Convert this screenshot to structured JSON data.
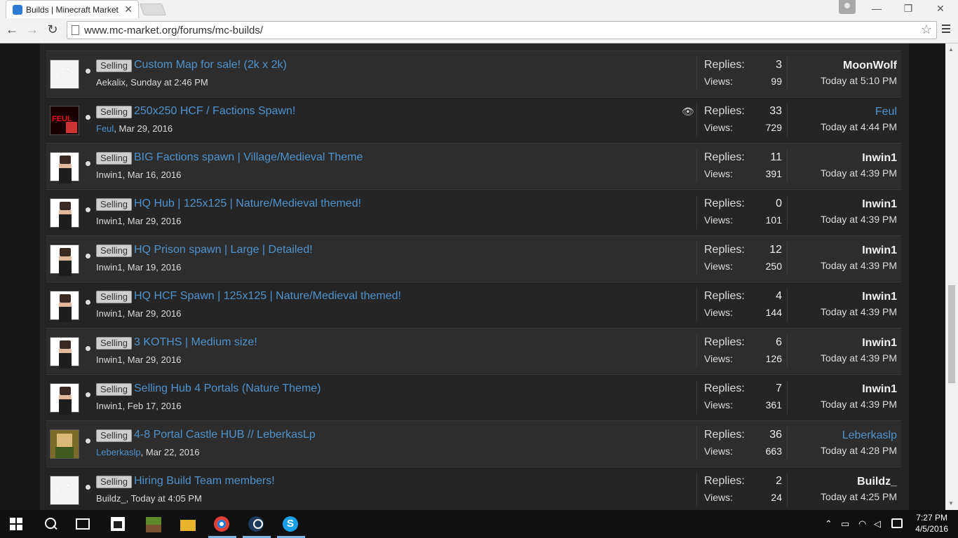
{
  "browser": {
    "tab_title": "Builds | Minecraft Market",
    "url": "www.mc-market.org/forums/mc-builds/",
    "close_tab": "✕",
    "minimize": "—",
    "restore": "❐",
    "close_window": "✕"
  },
  "threads": [
    {
      "prefix": "Selling",
      "title": "Custom Map for sale! (2k x 2k)",
      "author": "Aekalix",
      "date": ", Sunday at 2:46 PM",
      "replies_label": "Replies:",
      "replies": "3",
      "views_label": "Views:",
      "views": "99",
      "last_user": "MoonWolf",
      "last_date": "Today at 5:10 PM",
      "avatar": "gender",
      "author_link": false,
      "last_link": false
    },
    {
      "prefix": "Selling",
      "title": "250x250 HCF / Factions Spawn!",
      "author": "Feul",
      "date": ", Mar 29, 2016",
      "replies_label": "Replies:",
      "replies": "33",
      "views_label": "Views:",
      "views": "729",
      "last_user": "Feul",
      "last_date": "Today at 4:44 PM",
      "avatar": "feul",
      "author_link": true,
      "last_link": true,
      "watched": true
    },
    {
      "prefix": "Selling",
      "title": "BIG Factions spawn | Village/Medieval Theme",
      "author": "Inwin1",
      "date": ", Mar 16, 2016",
      "replies_label": "Replies:",
      "replies": "11",
      "views_label": "Views:",
      "views": "391",
      "last_user": "Inwin1",
      "last_date": "Today at 4:39 PM",
      "avatar": "skin",
      "author_link": false,
      "last_link": false
    },
    {
      "prefix": "Selling",
      "title": "HQ Hub | 125x125 | Nature/Medieval themed!",
      "author": "Inwin1",
      "date": ", Mar 29, 2016",
      "replies_label": "Replies:",
      "replies": "0",
      "views_label": "Views:",
      "views": "101",
      "last_user": "Inwin1",
      "last_date": "Today at 4:39 PM",
      "avatar": "skin",
      "author_link": false,
      "last_link": false
    },
    {
      "prefix": "Selling",
      "title": "HQ Prison spawn | Large | Detailed!",
      "author": "Inwin1",
      "date": ", Mar 19, 2016",
      "replies_label": "Replies:",
      "replies": "12",
      "views_label": "Views:",
      "views": "250",
      "last_user": "Inwin1",
      "last_date": "Today at 4:39 PM",
      "avatar": "skin",
      "author_link": false,
      "last_link": false
    },
    {
      "prefix": "Selling",
      "title": "HQ HCF Spawn | 125x125 | Nature/Medieval themed!",
      "author": "Inwin1",
      "date": ", Mar 29, 2016",
      "replies_label": "Replies:",
      "replies": "4",
      "views_label": "Views:",
      "views": "144",
      "last_user": "Inwin1",
      "last_date": "Today at 4:39 PM",
      "avatar": "skin",
      "author_link": false,
      "last_link": false
    },
    {
      "prefix": "Selling",
      "title": "3 KOTHS | Medium size!",
      "author": "Inwin1",
      "date": ", Mar 29, 2016",
      "replies_label": "Replies:",
      "replies": "6",
      "views_label": "Views:",
      "views": "126",
      "last_user": "Inwin1",
      "last_date": "Today at 4:39 PM",
      "avatar": "skin",
      "author_link": false,
      "last_link": false
    },
    {
      "prefix": "Selling",
      "title": "Selling Hub 4 Portals (Nature Theme)",
      "author": "Inwin1",
      "date": ", Feb 17, 2016",
      "replies_label": "Replies:",
      "replies": "7",
      "views_label": "Views:",
      "views": "361",
      "last_user": "Inwin1",
      "last_date": "Today at 4:39 PM",
      "avatar": "skin",
      "author_link": false,
      "last_link": false
    },
    {
      "prefix": "Selling",
      "title": "4-8 Portal Castle HUB // LeberkasLp",
      "author": "Leberkaslp",
      "date": ", Mar 22, 2016",
      "replies_label": "Replies:",
      "replies": "36",
      "views_label": "Views:",
      "views": "663",
      "last_user": "Leberkaslp",
      "last_date": "Today at 4:28 PM",
      "avatar": "leber",
      "author_link": true,
      "last_link": true
    },
    {
      "prefix": "Selling",
      "title": "Hiring Build Team members!",
      "author": "Buildz_",
      "date": ", Today at 4:05 PM",
      "replies_label": "Replies:",
      "replies": "2",
      "views_label": "Views:",
      "views": "24",
      "last_user": "Buildz_",
      "last_date": "Today at 4:25 PM",
      "avatar": "gender",
      "author_link": false,
      "last_link": false
    }
  ],
  "taskbar": {
    "time": "7:27 PM",
    "date": "4/5/2016"
  },
  "colors": {
    "link": "#4f93ce",
    "page_bg": "#171717",
    "row_bg": "#2d2d2d"
  }
}
